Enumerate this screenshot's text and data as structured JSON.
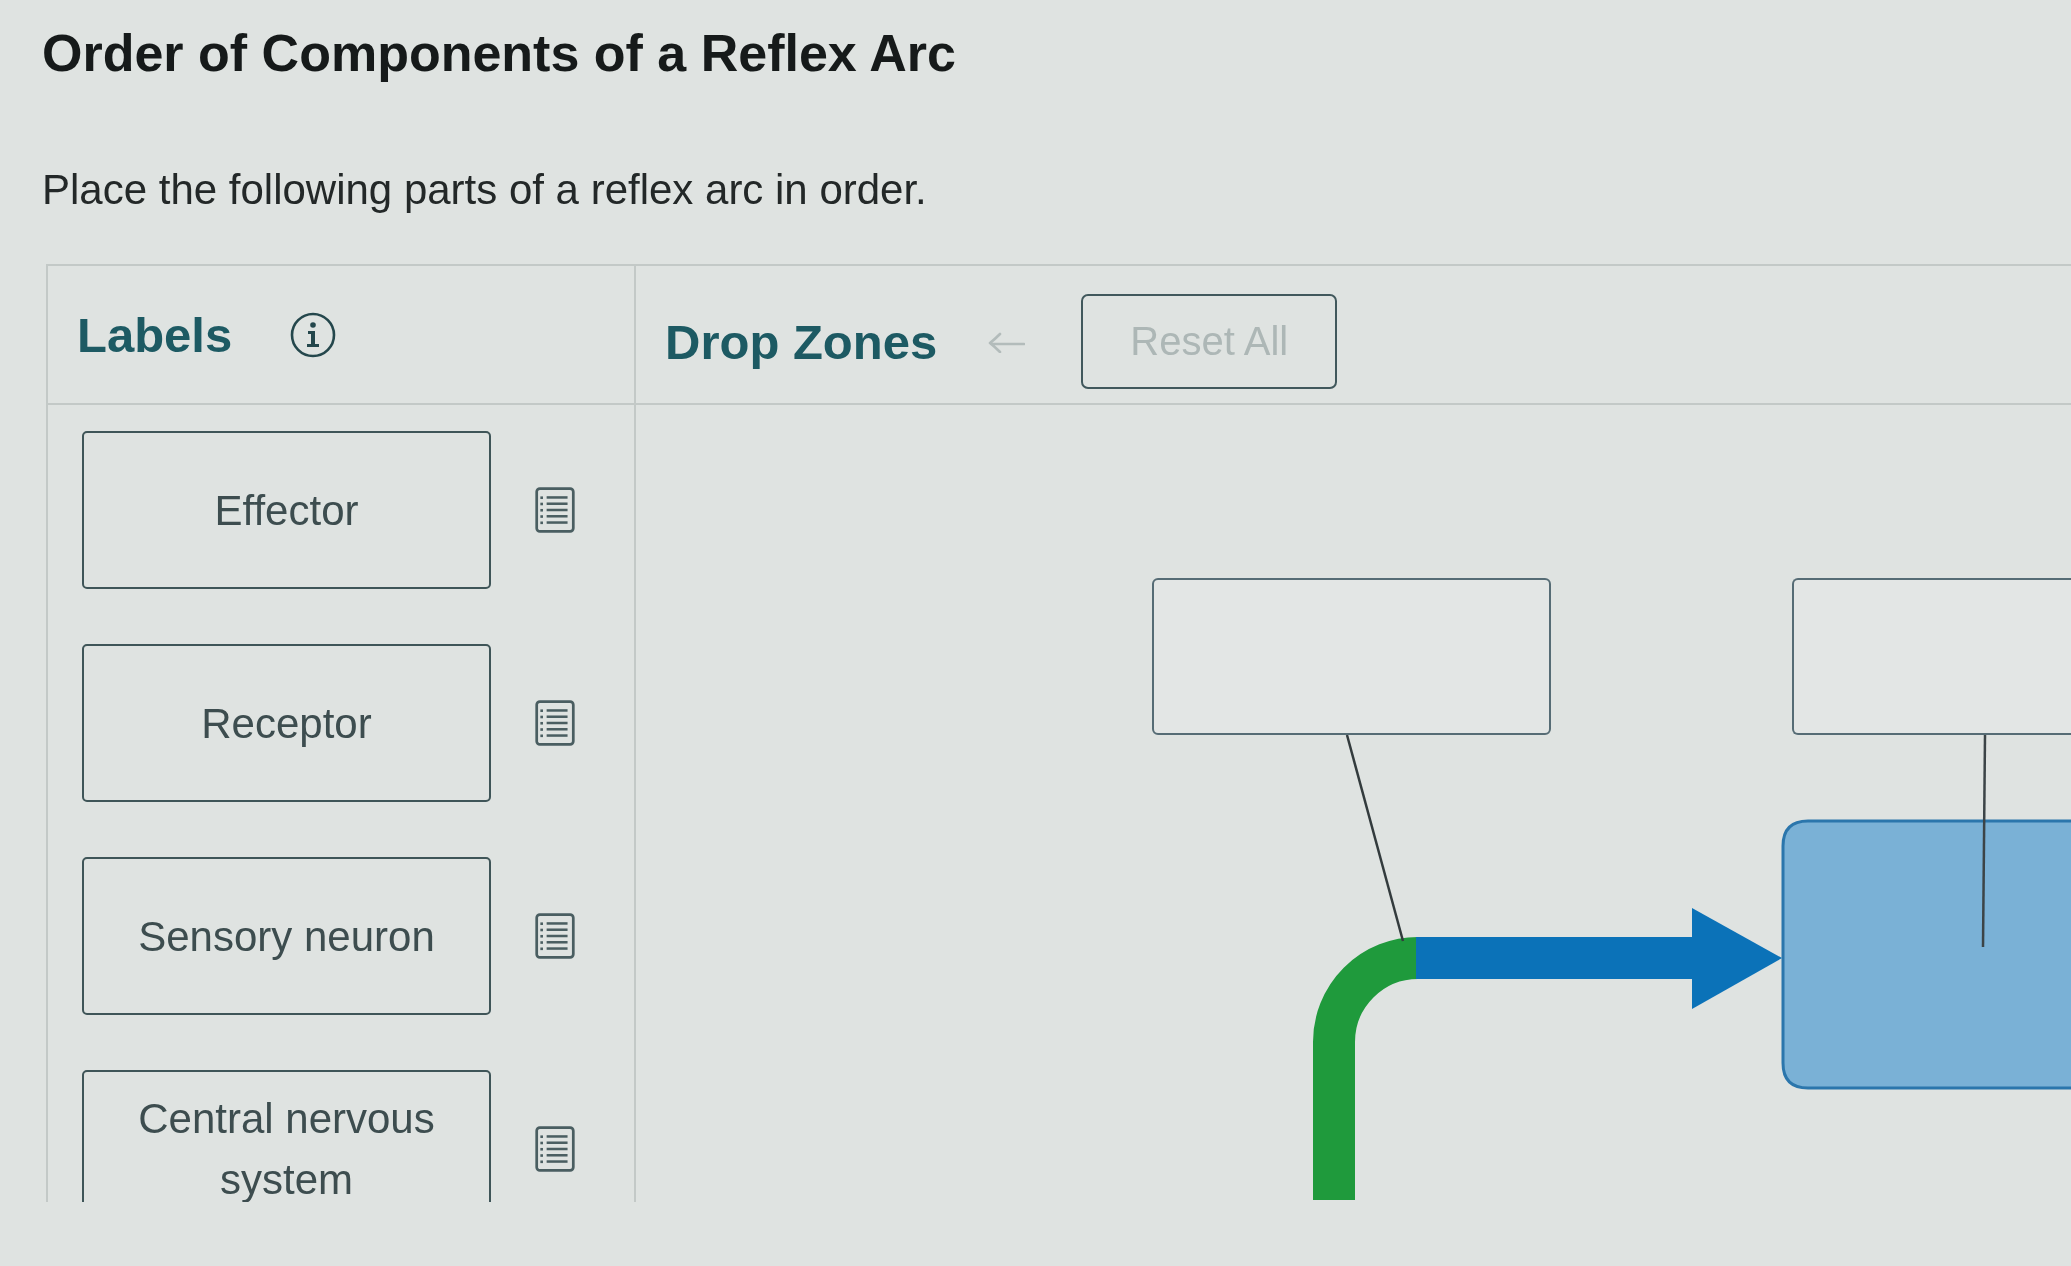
{
  "title": "Order of Components of a Reflex Arc",
  "instructions": "Place the following parts of a reflex arc in order.",
  "labels_panel": {
    "heading": "Labels",
    "labels": [
      "Effector",
      "Receptor",
      "Sensory neuron",
      "Central nervous system"
    ]
  },
  "drop_zones_panel": {
    "heading": "Drop Zones",
    "undo_button": {
      "disabled": true
    },
    "reset_button": {
      "label": "Reset All",
      "disabled": true
    }
  }
}
